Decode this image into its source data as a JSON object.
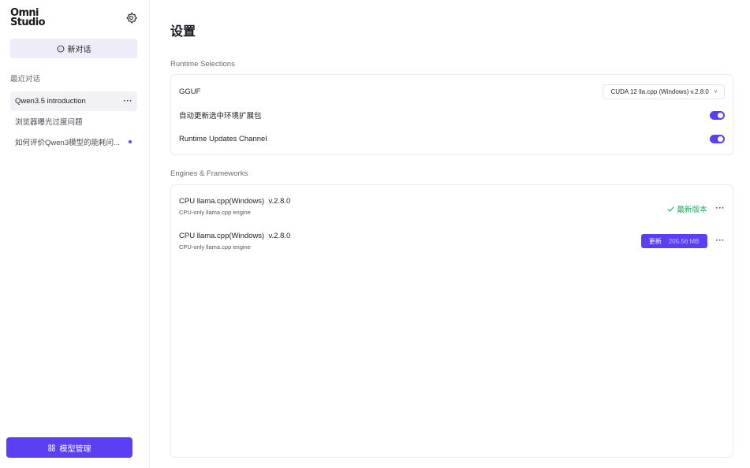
{
  "sidebar": {
    "logo": {
      "line1": "Omni",
      "line2": "Studio"
    },
    "settings_icon": "gear-icon",
    "new_chat_label": "新对话",
    "recent_label": "最近对话",
    "chats": [
      {
        "title": "Qwen3.5 introduction",
        "active": true,
        "more": "···"
      },
      {
        "title": "浏览器曝光过度问题",
        "active": false
      },
      {
        "title": "如何评价Qwen3模型的能耗问...",
        "active": false,
        "unread": true
      }
    ],
    "model_management_label": "模型管理"
  },
  "main": {
    "title": "设置",
    "runtime": {
      "section_title": "Runtime Selections",
      "gguf_label": "GGUF",
      "gguf_selected": "CUDA 12 lla.cpp (Windows)  v.2.8.0",
      "auto_update_label": "自动更新选中环境扩展包",
      "auto_update_on": true,
      "channel_label": "Runtime Updates Channel",
      "channel_on": true
    },
    "engines": {
      "section_title": "Engines & Frameworks",
      "items": [
        {
          "name": "CPU llama.cpp(Windows)  v.2.8.0",
          "desc": "CPU-only llama.cpp engine",
          "status_label": "最新版本",
          "more": "···"
        },
        {
          "name": "CPU llama.cpp(Windows)  v.2.8.0",
          "desc": "CPU-only llama.cpp engine",
          "update_label": "更新",
          "update_size": "205.56 MB",
          "more": "···"
        }
      ]
    }
  },
  "colors": {
    "accent": "#5b3ff5",
    "success": "#17b25f",
    "new_chat_bg": "#ededf9"
  }
}
